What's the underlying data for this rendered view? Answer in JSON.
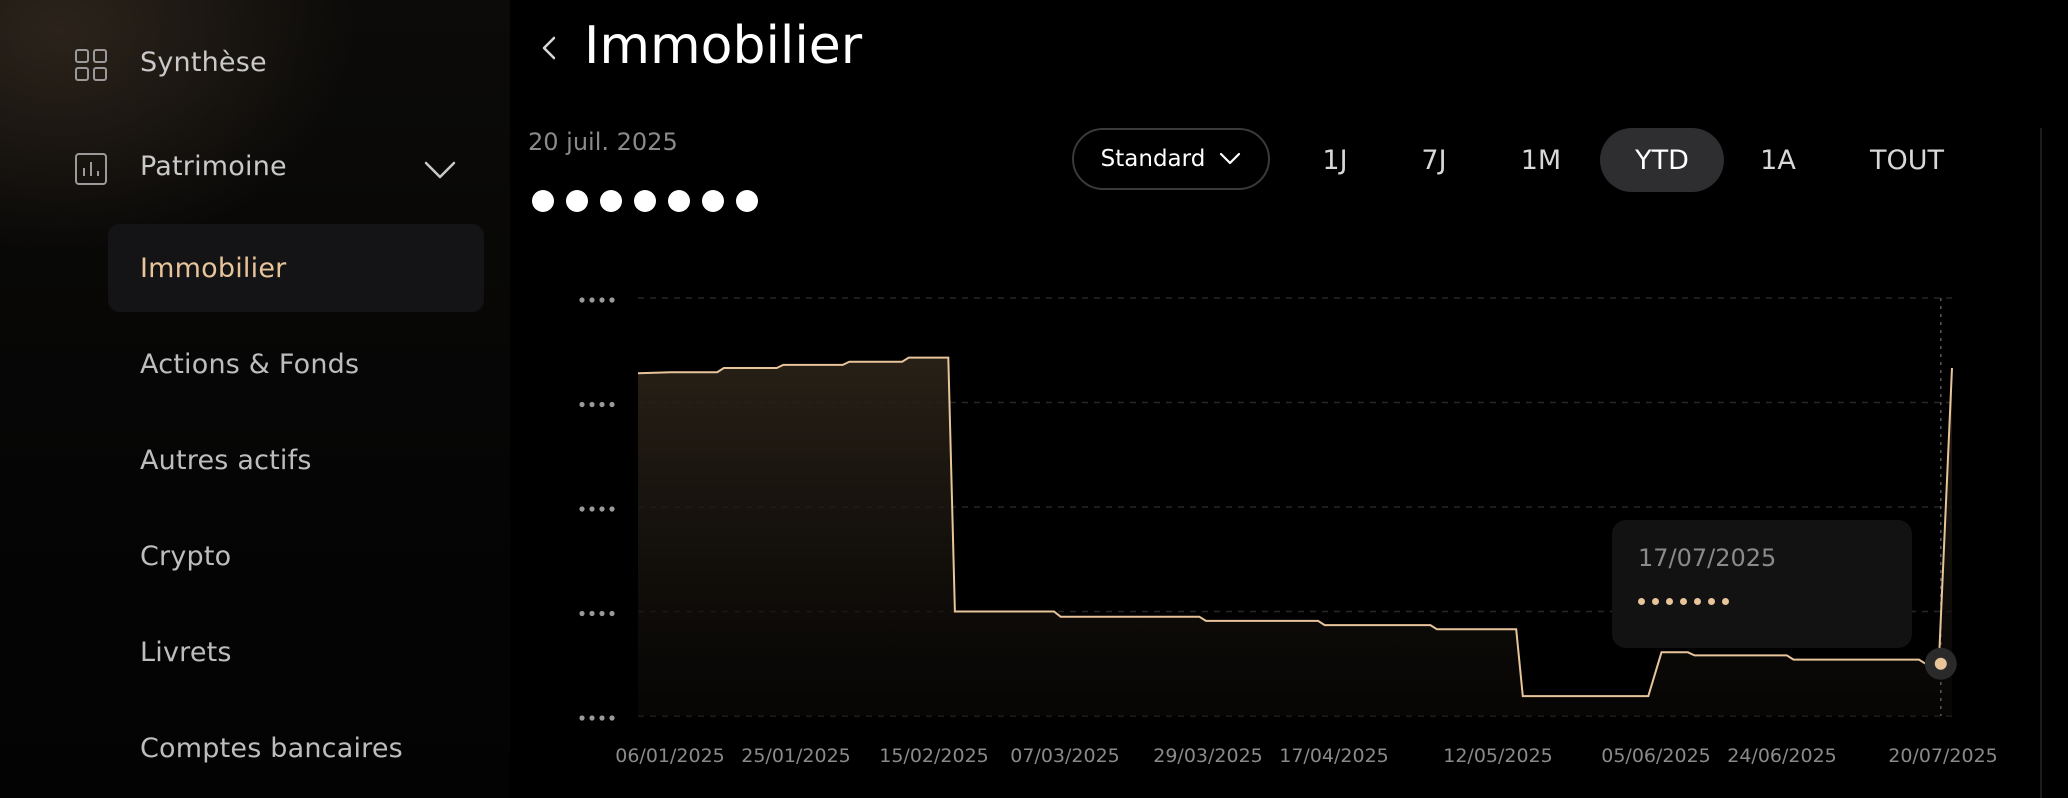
{
  "sidebar": {
    "synthese": "Synthèse",
    "patrimoine": "Patrimoine",
    "sub_items": [
      "Immobilier",
      "Actions & Fonds",
      "Autres actifs",
      "Crypto",
      "Livrets",
      "Comptes bancaires"
    ],
    "active_index": 0,
    "icons": [
      "grid-icon",
      "bar-chart-icon",
      "chevron-down-icon"
    ]
  },
  "header": {
    "title": "Immobilier",
    "date": "20 juil. 2025",
    "masked_value_dots": 7
  },
  "controls": {
    "mode_label": "Standard",
    "ranges": [
      "1J",
      "7J",
      "1M",
      "YTD",
      "1A",
      "TOUT"
    ],
    "active_range": "YTD"
  },
  "colors": {
    "accent": "#e8c49a",
    "background": "#000000",
    "active_pill": "#2e2e30"
  },
  "tooltip": {
    "date": "17/07/2025",
    "masked_dots": 7
  },
  "chart_data": {
    "type": "area",
    "x_tick_labels": [
      "06/01/2025",
      "25/01/2025",
      "15/02/2025",
      "07/03/2025",
      "29/03/2025",
      "17/04/2025",
      "12/05/2025",
      "05/06/2025",
      "24/06/2025",
      "20/07/2025"
    ],
    "y_tick_labels_masked": true,
    "y_tick_count": 5,
    "grid": "horizontal dashed",
    "ylim": [
      0,
      4
    ],
    "series": [
      {
        "points": [
          [
            "2025-01-01",
            3.28
          ],
          [
            "2025-01-06",
            3.29
          ],
          [
            "2025-01-13",
            3.29
          ],
          [
            "2025-01-14",
            3.33
          ],
          [
            "2025-01-22",
            3.33
          ],
          [
            "2025-01-23",
            3.36
          ],
          [
            "2025-02-01",
            3.36
          ],
          [
            "2025-02-02",
            3.39
          ],
          [
            "2025-02-10",
            3.39
          ],
          [
            "2025-02-11",
            3.43
          ],
          [
            "2025-02-17",
            3.43
          ],
          [
            "2025-02-18",
            1.0
          ],
          [
            "2025-03-05",
            1.0
          ],
          [
            "2025-03-06",
            0.95
          ],
          [
            "2025-03-27",
            0.95
          ],
          [
            "2025-03-28",
            0.91
          ],
          [
            "2025-04-14",
            0.91
          ],
          [
            "2025-04-15",
            0.87
          ],
          [
            "2025-05-01",
            0.87
          ],
          [
            "2025-05-02",
            0.83
          ],
          [
            "2025-05-14",
            0.83
          ],
          [
            "2025-05-15",
            0.19
          ],
          [
            "2025-06-03",
            0.19
          ],
          [
            "2025-06-05",
            0.61
          ],
          [
            "2025-06-09",
            0.61
          ],
          [
            "2025-06-10",
            0.58
          ],
          [
            "2025-06-24",
            0.58
          ],
          [
            "2025-06-25",
            0.54
          ],
          [
            "2025-07-14",
            0.54
          ],
          [
            "2025-07-15",
            0.5
          ],
          [
            "2025-07-17",
            0.5
          ],
          [
            "2025-07-19",
            3.33
          ]
        ]
      }
    ],
    "highlight_point": [
      "2025-07-17",
      0.5
    ]
  }
}
